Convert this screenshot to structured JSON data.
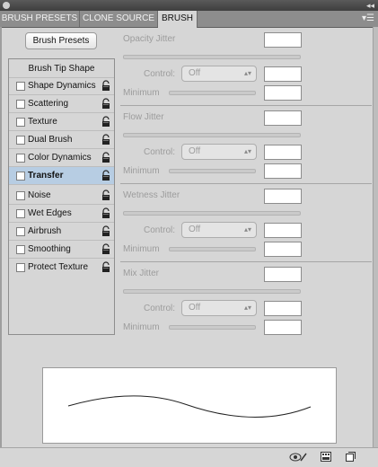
{
  "tabs": [
    {
      "label": "BRUSH PRESETS"
    },
    {
      "label": "CLONE SOURCE"
    },
    {
      "label": "BRUSH"
    }
  ],
  "brush_presets_button": "Brush Presets",
  "tip_shape_label": "Brush Tip Shape",
  "sidebar": {
    "items": [
      {
        "label": "Shape Dynamics"
      },
      {
        "label": "Scattering"
      },
      {
        "label": "Texture"
      },
      {
        "label": "Dual Brush"
      },
      {
        "label": "Color Dynamics"
      },
      {
        "label": "Transfer"
      },
      {
        "label": "Noise"
      },
      {
        "label": "Wet Edges"
      },
      {
        "label": "Airbrush"
      },
      {
        "label": "Smoothing"
      },
      {
        "label": "Protect Texture"
      }
    ],
    "selected": "Transfer"
  },
  "settings": {
    "groups": [
      {
        "title": "Opacity Jitter",
        "control_label": "Control:",
        "control_value": "Off",
        "minimum_label": "Minimum"
      },
      {
        "title": "Flow Jitter",
        "control_label": "Control:",
        "control_value": "Off",
        "minimum_label": "Minimum"
      },
      {
        "title": "Wetness Jitter",
        "control_label": "Control:",
        "control_value": "Off",
        "minimum_label": "Minimum"
      },
      {
        "title": "Mix Jitter",
        "control_label": "Control:",
        "control_value": "Off",
        "minimum_label": "Minimum"
      }
    ]
  },
  "colors": {
    "panel_bg": "#d6d6d6",
    "tab_bar": "#8d8d8d",
    "selected_item": "#b7cde3",
    "disabled_text": "#9c9c9c"
  },
  "icons": [
    "lock-icon",
    "panel-menu-icon",
    "toggle-live-preview-icon",
    "brush-panel-icon",
    "new-preset-icon",
    "collapse-arrows-icon"
  ]
}
